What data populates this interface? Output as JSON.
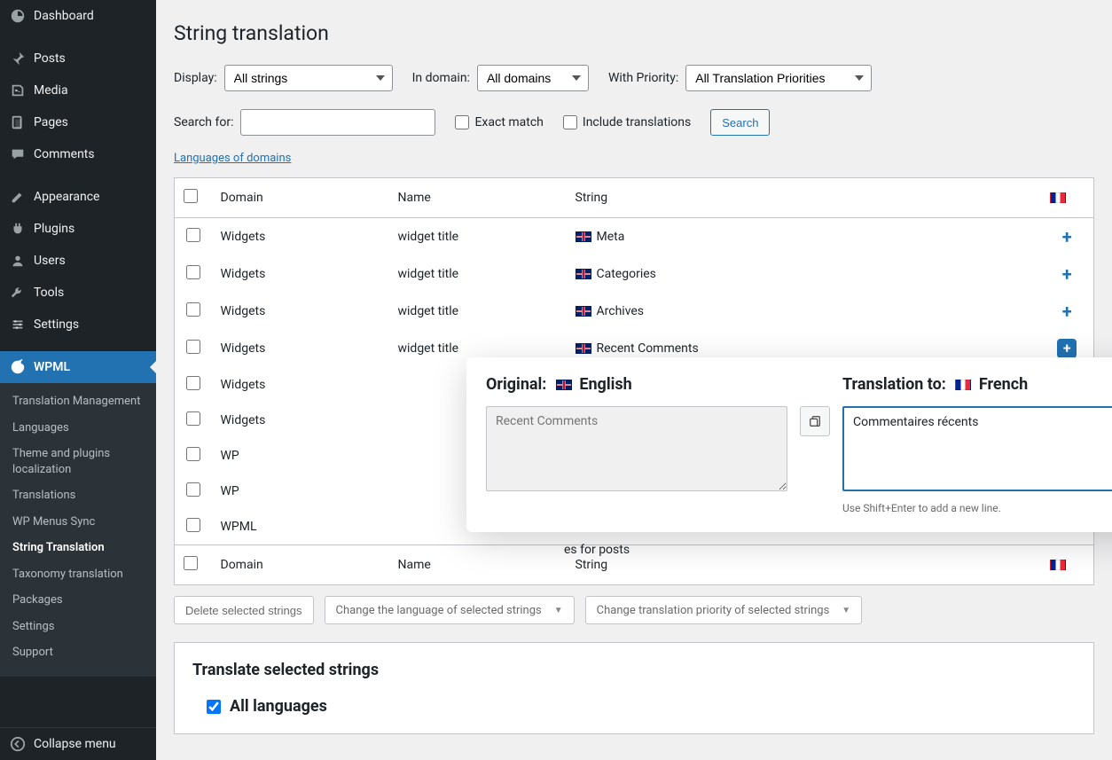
{
  "sidebar": {
    "items": [
      {
        "label": "Dashboard",
        "icon": "dashboard"
      },
      {
        "label": "Posts",
        "icon": "pin"
      },
      {
        "label": "Media",
        "icon": "media"
      },
      {
        "label": "Pages",
        "icon": "pages"
      },
      {
        "label": "Comments",
        "icon": "comments"
      },
      {
        "label": "Appearance",
        "icon": "appearance"
      },
      {
        "label": "Plugins",
        "icon": "plugins"
      },
      {
        "label": "Users",
        "icon": "users"
      },
      {
        "label": "Tools",
        "icon": "tools"
      },
      {
        "label": "Settings",
        "icon": "settings"
      },
      {
        "label": "WPML",
        "icon": "wpml",
        "active": true
      }
    ],
    "submenu": [
      "Translation Management",
      "Languages",
      "Theme and plugins localization",
      "Translations",
      "WP Menus Sync",
      "String Translation",
      "Taxonomy translation",
      "Packages",
      "Settings",
      "Support"
    ],
    "submenu_current": "String Translation",
    "collapse": "Collapse menu"
  },
  "page": {
    "title": "String translation",
    "filters": {
      "display_label": "Display:",
      "display_value": "All strings",
      "domain_label": "In domain:",
      "domain_value": "All domains",
      "priority_label": "With Priority:",
      "priority_value": "All Translation Priorities",
      "search_label": "Search for:",
      "search_value": "",
      "exact_match": "Exact match",
      "include_translations": "Include translations",
      "search_btn": "Search"
    },
    "lang_domains_link": "Languages of domains",
    "table": {
      "headers": {
        "domain": "Domain",
        "name": "Name",
        "string": "String"
      },
      "target_flag": "fr",
      "rows": [
        {
          "domain": "Widgets",
          "name": "widget title",
          "flag": "uk",
          "string": "Meta",
          "action": "plus"
        },
        {
          "domain": "Widgets",
          "name": "widget title",
          "flag": "uk",
          "string": "Categories",
          "action": "plus"
        },
        {
          "domain": "Widgets",
          "name": "widget title",
          "flag": "uk",
          "string": "Archives",
          "action": "plus"
        },
        {
          "domain": "Widgets",
          "name": "widget title",
          "flag": "uk",
          "string": "Recent Comments",
          "action": "plus-filled"
        },
        {
          "domain": "Widgets",
          "name": "",
          "flag": "",
          "string": "",
          "action": ""
        },
        {
          "domain": "Widgets",
          "name": "",
          "flag": "",
          "string": "",
          "action": ""
        },
        {
          "domain": "WP",
          "name": "",
          "flag": "",
          "string": "",
          "action": ""
        },
        {
          "domain": "WP",
          "name": "",
          "flag": "",
          "string": "",
          "action": ""
        },
        {
          "domain": "WPML",
          "name": "",
          "flag": "",
          "string": "",
          "action": ""
        }
      ],
      "partial_below_popup": "es for posts"
    },
    "bulk": {
      "delete": "Delete selected strings",
      "change_lang": "Change the language of selected strings",
      "change_priority": "Change translation priority of selected strings"
    },
    "translate_section": {
      "heading": "Translate selected strings",
      "all_languages": "All languages"
    }
  },
  "popup": {
    "original_label": "Original:",
    "original_lang": "English",
    "original_text": "Recent Comments",
    "translation_label": "Translation to:",
    "translation_lang": "French",
    "translation_text": "Commentaires récents",
    "hint": "Use Shift+Enter to add a new line."
  }
}
